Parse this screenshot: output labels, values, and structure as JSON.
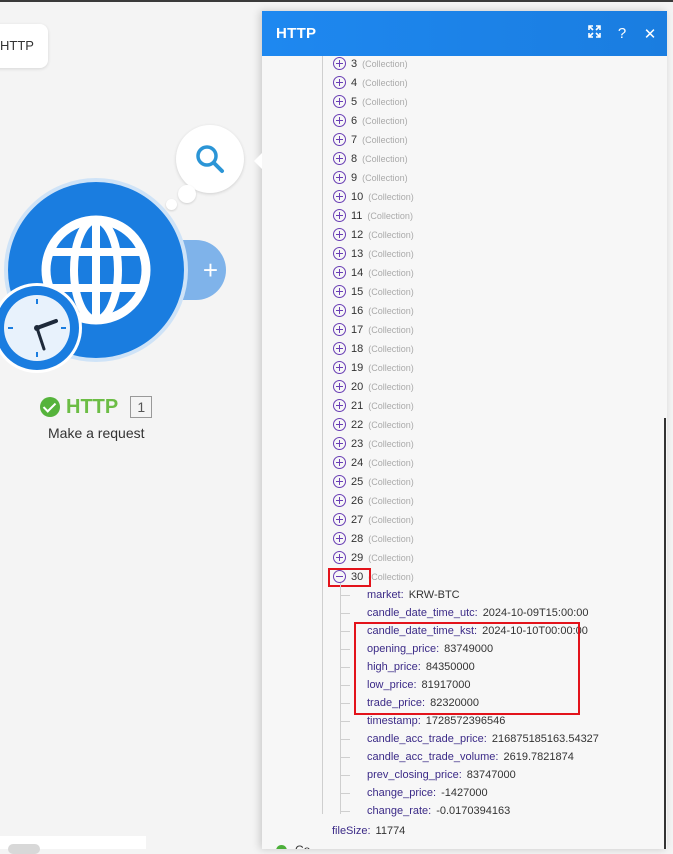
{
  "canvas": {
    "chip_label": "HTTP",
    "module": {
      "title": "HTTP",
      "count": "1",
      "subtitle": "Make a request"
    }
  },
  "panel": {
    "title": "HTTP",
    "icons": {
      "expand": "expand-icon",
      "help": "?",
      "close": "✕"
    },
    "collapsed_items": [
      {
        "index": "3",
        "type": "(Collection)"
      },
      {
        "index": "4",
        "type": "(Collection)"
      },
      {
        "index": "5",
        "type": "(Collection)"
      },
      {
        "index": "6",
        "type": "(Collection)"
      },
      {
        "index": "7",
        "type": "(Collection)"
      },
      {
        "index": "8",
        "type": "(Collection)"
      },
      {
        "index": "9",
        "type": "(Collection)"
      },
      {
        "index": "10",
        "type": "(Collection)"
      },
      {
        "index": "11",
        "type": "(Collection)"
      },
      {
        "index": "12",
        "type": "(Collection)"
      },
      {
        "index": "13",
        "type": "(Collection)"
      },
      {
        "index": "14",
        "type": "(Collection)"
      },
      {
        "index": "15",
        "type": "(Collection)"
      },
      {
        "index": "16",
        "type": "(Collection)"
      },
      {
        "index": "17",
        "type": "(Collection)"
      },
      {
        "index": "18",
        "type": "(Collection)"
      },
      {
        "index": "19",
        "type": "(Collection)"
      },
      {
        "index": "20",
        "type": "(Collection)"
      },
      {
        "index": "21",
        "type": "(Collection)"
      },
      {
        "index": "22",
        "type": "(Collection)"
      },
      {
        "index": "23",
        "type": "(Collection)"
      },
      {
        "index": "24",
        "type": "(Collection)"
      },
      {
        "index": "25",
        "type": "(Collection)"
      },
      {
        "index": "26",
        "type": "(Collection)"
      },
      {
        "index": "27",
        "type": "(Collection)"
      },
      {
        "index": "28",
        "type": "(Collection)"
      },
      {
        "index": "29",
        "type": "(Collection)"
      }
    ],
    "expanded_item": {
      "index": "30",
      "type": "(Collection)",
      "fields": [
        {
          "key": "market:",
          "value": "KRW-BTC"
        },
        {
          "key": "candle_date_time_utc:",
          "value": "2024-10-09T15:00:00"
        },
        {
          "key": "candle_date_time_kst:",
          "value": "2024-10-10T00:00:00"
        },
        {
          "key": "opening_price:",
          "value": "83749000"
        },
        {
          "key": "high_price:",
          "value": "84350000"
        },
        {
          "key": "low_price:",
          "value": "81917000"
        },
        {
          "key": "trade_price:",
          "value": "82320000"
        },
        {
          "key": "timestamp:",
          "value": "1728572396546"
        },
        {
          "key": "candle_acc_trade_price:",
          "value": "216875185163.54327"
        },
        {
          "key": "candle_acc_trade_volume:",
          "value": "2619.7821874"
        },
        {
          "key": "prev_closing_price:",
          "value": "83747000"
        },
        {
          "key": "change_price:",
          "value": "-1427000"
        },
        {
          "key": "change_rate:",
          "value": "-0.0170394163"
        }
      ]
    },
    "file_size": {
      "key": "fileSize:",
      "value": "11774"
    },
    "bottom_label": "Co...",
    "colors": {
      "header": "#1a7de0",
      "highlight": "#e3131b",
      "key": "#3b2a87",
      "toggle": "#6a3fb5"
    }
  }
}
